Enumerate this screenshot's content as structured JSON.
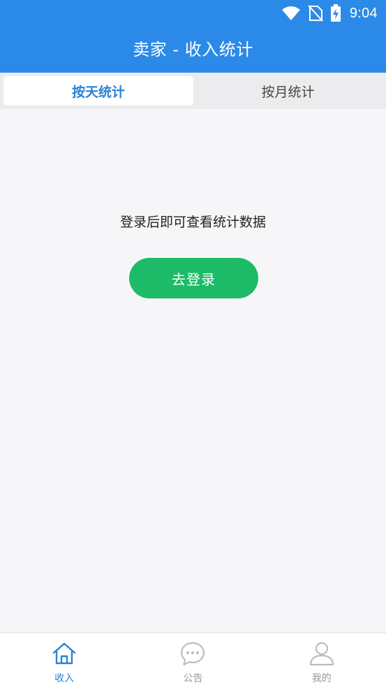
{
  "status_bar": {
    "time": "9:04",
    "icons": [
      "wifi-icon",
      "no-sim-icon",
      "battery-charging-icon"
    ]
  },
  "header": {
    "title": "卖家 - 收入统计"
  },
  "tabs": [
    {
      "label": "按天统计",
      "active": true
    },
    {
      "label": "按月统计",
      "active": false
    }
  ],
  "empty_state": {
    "message": "登录后即可查看统计数据",
    "login_button": "去登录"
  },
  "bottom_nav": [
    {
      "label": "收入",
      "icon": "home-icon",
      "active": true
    },
    {
      "label": "公告",
      "icon": "chat-bubble-icon",
      "active": false
    },
    {
      "label": "我的",
      "icon": "person-icon",
      "active": false
    }
  ],
  "colors": {
    "primary": "#2b8ae8",
    "active_text": "#2b82d6",
    "login_button": "#1dbb67",
    "background": "#f6f6f8"
  }
}
